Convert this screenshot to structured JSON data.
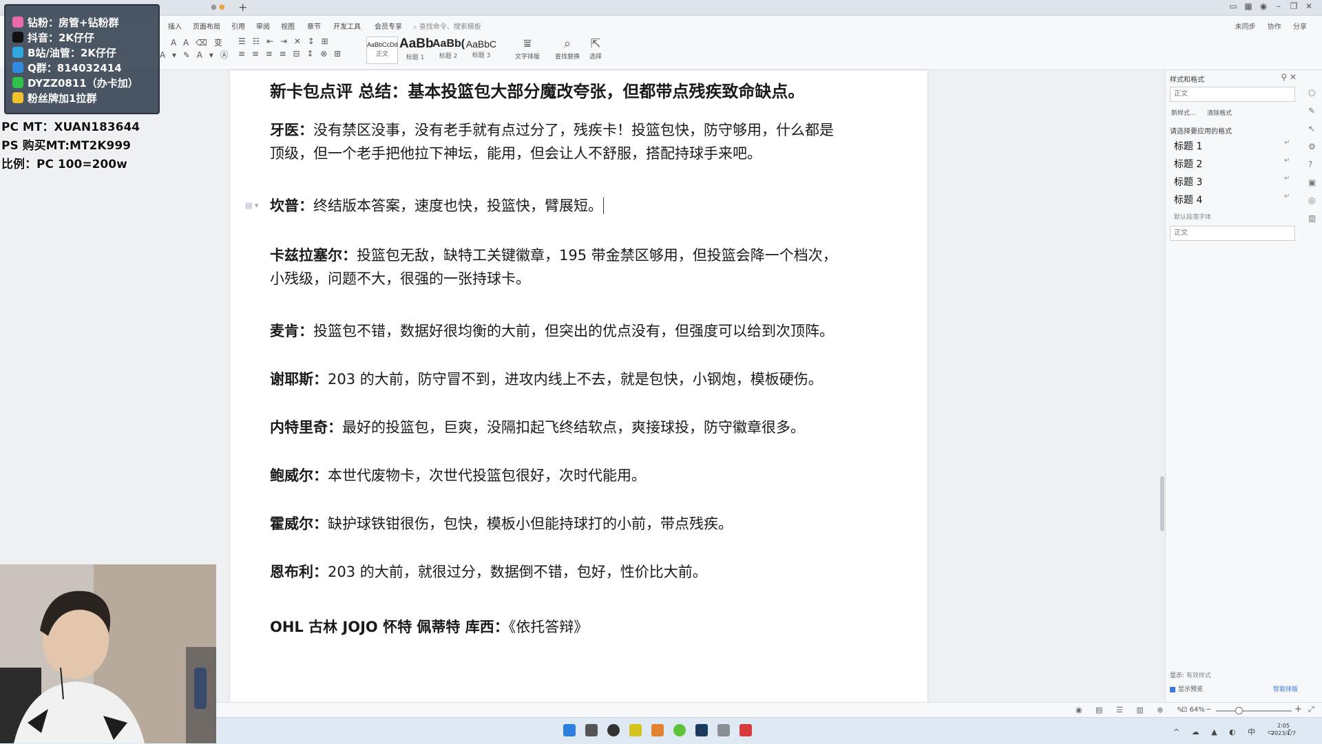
{
  "menu": {
    "items": [
      "插入",
      "页面布局",
      "引用",
      "审阅",
      "视图",
      "章节",
      "开发工具",
      "会员专享"
    ],
    "search_placeholder": "查找命令、搜索模板",
    "right_actions": [
      "未同步",
      "协作",
      "分享"
    ]
  },
  "ribbon": {
    "styles": [
      {
        "preview": "AaBbCcDd",
        "label": "正文"
      },
      {
        "preview": "AaBb",
        "label": "标题 1"
      },
      {
        "preview": "AaBb(",
        "label": "标题 2"
      },
      {
        "preview": "AaBbC",
        "label": "标题 3"
      }
    ],
    "tools": [
      {
        "label": "文字排版",
        "icon": "text-layout-icon"
      },
      {
        "label": "查找替换",
        "icon": "find-replace-icon"
      },
      {
        "label": "选择",
        "icon": "select-icon"
      }
    ]
  },
  "document": {
    "title": "新卡包点评 总结：基本投篮包大部分魔改夸张，但都带点残疾致命缺点。",
    "paragraphs": [
      {
        "name": "牙医",
        "lines": [
          "没有禁区没事，没有老手就有点过分了，残疾卡！投篮包快，防守够用，什么都是",
          "顶级，但一个老手把他拉下神坛，能用，但会让人不舒服，搭配持球手来吧。"
        ]
      },
      {
        "name": "坎普",
        "lines": [
          "终结版本答案，速度也快，投篮快，臂展短。"
        ]
      },
      {
        "name": "卡兹拉塞尔",
        "lines": [
          "投篮包无敌，缺特工关键徽章，195 带金禁区够用，但投篮会降一个档次，",
          "小残级，问题不大，很强的一张持球卡。"
        ]
      },
      {
        "name": "麦肯",
        "lines": [
          "投篮包不错，数据好很均衡的大前，但突出的优点没有，但强度可以给到次顶阵。"
        ]
      },
      {
        "name": "谢耶斯",
        "lines": [
          "203 的大前，防守冒不到，进攻内线上不去，就是包快，小钢炮，模板硬伤。"
        ]
      },
      {
        "name": "内特里奇",
        "lines": [
          "最好的投篮包，巨爽，没隔扣起飞终结软点，爽接球投，防守徽章很多。"
        ]
      },
      {
        "name": "鲍威尔",
        "lines": [
          "本世代废物卡，次世代投篮包很好，次时代能用。"
        ]
      },
      {
        "name": "霍威尔",
        "lines": [
          "缺护球铁钳很伤，包快，模板小但能持球打的小前，带点残疾。"
        ]
      },
      {
        "name": "恩布利",
        "lines": [
          "203 的大前，就很过分，数据倒不错，包好，性价比大前。"
        ]
      }
    ],
    "footer_line": {
      "names": "OHL 古林 JOJO 怀特 佩蒂特 库西",
      "rest": "《依托答辩》"
    }
  },
  "styles_pane": {
    "title": "样式和格式",
    "current_style": "正文",
    "buttons": [
      "新样式...",
      "清除格式"
    ],
    "hint": "请选择要应用的格式",
    "headings": [
      "标题 1",
      "标题 2",
      "标题 3",
      "标题 4"
    ],
    "default_font_label": "默认段落字体",
    "selected_style": "正文",
    "show_label": "显示:",
    "show_value": "有效样式",
    "preview_label": "显示预览",
    "smart_label": "智能排版"
  },
  "status": {
    "zoom": "64%"
  },
  "clock": {
    "time": "2:05",
    "date": "2023/1/7"
  },
  "tray_ime": "中",
  "overlay": {
    "card_lines": [
      {
        "text": "钻粉：房管+钻粉群",
        "color": "#e86aa8"
      },
      {
        "text": "抖音：2K仔仔",
        "color": "#111111"
      },
      {
        "text": "B站/油管：2K仔仔",
        "color": "#2fa7e0"
      },
      {
        "text": "Q群：814032414",
        "color": "#2f8be0"
      },
      {
        "text": "DYZZ0811（办卡加）",
        "color": "#2fc24a"
      },
      {
        "text": "粉丝牌加1拉群",
        "color": "#f2c12e"
      }
    ],
    "plain_lines": [
      "PC MT：XUAN183644",
      "PS 购买MT:MT2K999",
      "比例：PC 100=200w"
    ]
  },
  "colors": {
    "accent": "#3c7be0",
    "taskbar": "#dfe9f3"
  }
}
